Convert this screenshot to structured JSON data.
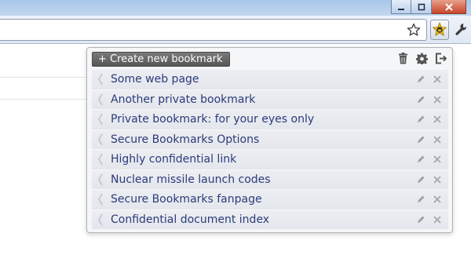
{
  "popup": {
    "create_label": "+ Create new bookmark",
    "header_icons": [
      "trash-icon",
      "gear-icon",
      "logout-icon"
    ]
  },
  "bookmarks": [
    {
      "label": "Some web page"
    },
    {
      "label": "Another private bookmark"
    },
    {
      "label": "Private bookmark: for your eyes only"
    },
    {
      "label": "Secure Bookmarks Options"
    },
    {
      "label": "Highly confidential link"
    },
    {
      "label": "Nuclear missile launch codes"
    },
    {
      "label": "Secure Bookmarks fanpage"
    },
    {
      "label": "Confidential document index"
    }
  ],
  "row_icons": [
    "drag-handle-icon",
    "edit-pencil-icon",
    "delete-x-icon"
  ],
  "toolbar_icons": [
    "star-icon",
    "secure-bookmarks-extension-icon",
    "wrench-icon"
  ],
  "colors": {
    "bookmark_text": "#2b3b7a",
    "create_button_bg": "#6a6a6a",
    "row_bg": "#e6e9ee"
  }
}
